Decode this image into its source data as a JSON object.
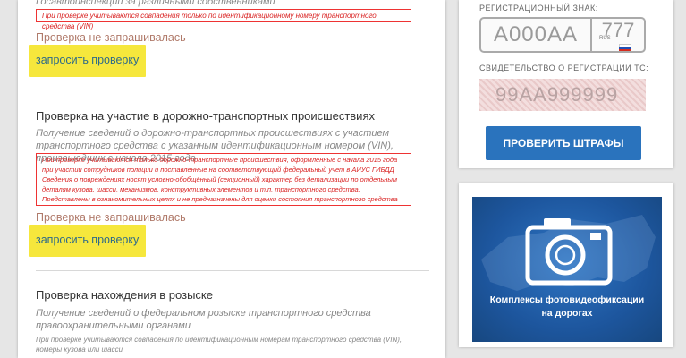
{
  "section_top": {
    "subtitle_cut": "Госавтоинспекции за различными собственниками",
    "note": "При проверке учитываются совпадения только по идентификационному номеру транспортного средства (VIN)",
    "status": "Проверка не запрашивалась",
    "request_button": "запросить проверку"
  },
  "section_dtp": {
    "title": "Проверка на участие в дорожно-транспортных происшествиях",
    "description": "Получение сведений о дорожно-транспортных происшествиях с участием транспортного средства с указанным идентификационным номером (VIN), произошедших с начала 2015 года",
    "note_lines": [
      "При проверке учитываются только дорожно-транспортные происшествия, оформленные с начала 2015 года",
      "при участии сотрудников полиции и поставленные на соответствующий федеральный учет в АИУС ГИБДД",
      "Сведения о повреждениях носят условно-обобщённый (секционный) характер без детализации по отдельным",
      "деталям кузова, шасси, механизмов, конструктивных элементов и т.п. транспортного средства.",
      "Представлены в ознакомительных целях и не предназначены для оценки состояния транспортного средства"
    ],
    "status": "Проверка не запрашивалась",
    "request_button": "запросить проверку"
  },
  "section_wanted": {
    "title": "Проверка нахождения в розыске",
    "description": "Получение сведений о федеральном розыске транспортного средства правоохранительными органами",
    "note": "При проверке учитываются совпадения по идентификационным номерам транспортного средства (VIN), номеры кузова или шасси"
  },
  "sidebar": {
    "reg_label": "РЕГИСТРАЦИОННЫЙ ЗНАК:",
    "plate_number": "А000АА",
    "plate_region": "777",
    "plate_country": "RUS",
    "cert_label": "СВИДЕТЕЛЬСТВО О РЕГИСТРАЦИИ ТС:",
    "cert_number": "99АА999999",
    "fines_button": "ПРОВЕРИТЬ ШТРАФЫ",
    "banner_line1": "Комплексы фотовидеофиксации",
    "banner_line2": "на дорогах",
    "banner_icon": "camera-icon"
  },
  "colors": {
    "accent_blue": "#2a73bd",
    "button_yellow": "#f6e73c",
    "note_red": "#d92323",
    "status_brown": "#b07a6a"
  }
}
